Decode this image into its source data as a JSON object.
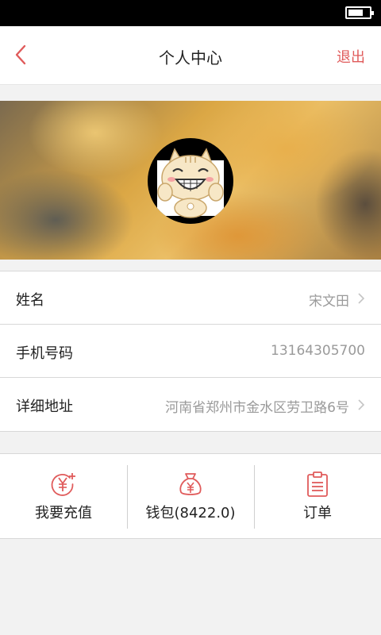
{
  "header": {
    "title": "个人中心",
    "logout_label": "退出",
    "back_icon": "chevron-left-icon",
    "accent_color": "#e05b5b"
  },
  "status_bar": {
    "battery_icon": "battery-icon"
  },
  "profile": {
    "avatar_icon": "cat-avatar"
  },
  "info": {
    "rows": [
      {
        "label": "姓名",
        "value": "宋文田"
      },
      {
        "label": "手机号码",
        "value": "13164305700"
      },
      {
        "label": "详细地址",
        "value": "河南省郑州市金水区劳卫路6号"
      }
    ]
  },
  "actions": {
    "items": [
      {
        "label": "我要充值",
        "icon": "yen-coin-plus-icon"
      },
      {
        "label": "钱包(8422.0)",
        "icon": "money-bag-icon"
      },
      {
        "label": "订单",
        "icon": "clipboard-list-icon"
      }
    ]
  }
}
